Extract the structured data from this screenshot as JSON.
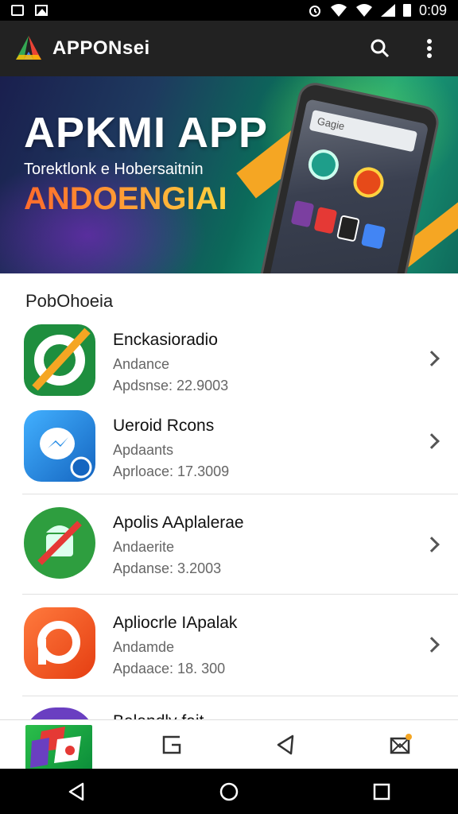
{
  "status_bar": {
    "time": "0:09",
    "icons": [
      "screenshot-icon",
      "image-icon",
      "alarm-icon",
      "wifi-icon",
      "signal-icon",
      "battery-icon"
    ]
  },
  "app_bar": {
    "title": "APPONsei",
    "logo": "app-logo-icon",
    "actions": [
      "search-icon",
      "more-vert-icon"
    ]
  },
  "banner": {
    "title": "APKMI APP",
    "subtitle": "Torektlonk e Hobersaitnin",
    "headline": "ANDOENGIAI",
    "phone_search": "Gagie"
  },
  "section": {
    "title": "PobOhoeia"
  },
  "apps": [
    {
      "name": "Enckasioradio",
      "category": "Andance",
      "updated": "Apdsnse: 22.9003",
      "icon": "slash-green-icon",
      "colors": [
        "#1e8e3e",
        "#f5a623"
      ]
    },
    {
      "name": "Ueroid Rcons",
      "category": "Apdaants",
      "updated": "Aprloace: 17.3009",
      "icon": "messenger-blue-icon",
      "colors": [
        "#2196f3",
        "#ffffff"
      ]
    },
    {
      "name": "Apolis AAplalerae",
      "category": "Andaerite",
      "updated": "Apdanse: 3.2003",
      "icon": "android-no-icon",
      "colors": [
        "#2e9e3f",
        "#e53935"
      ]
    },
    {
      "name": "Apliocrle IApalak",
      "category": "Andamde",
      "updated": "Apdaace: 18. 300",
      "icon": "circle-orange-icon",
      "colors": [
        "#ff5722",
        "#ffffff"
      ]
    },
    {
      "name": "Balandly fait",
      "category": "",
      "updated": "",
      "icon": "partial-purple-icon",
      "colors": [
        "#6a3fc1",
        "#ffffff"
      ]
    }
  ],
  "tab_bar": {
    "tabs": [
      "thumbnail-tab",
      "layout-icon",
      "navigate-icon",
      "notifications-icon"
    ]
  },
  "nav_bar": {
    "buttons": [
      "back-icon",
      "home-icon",
      "recents-icon"
    ]
  },
  "colors": {
    "app_bar_bg": "#222222",
    "accent_orange": "#f5a623"
  }
}
